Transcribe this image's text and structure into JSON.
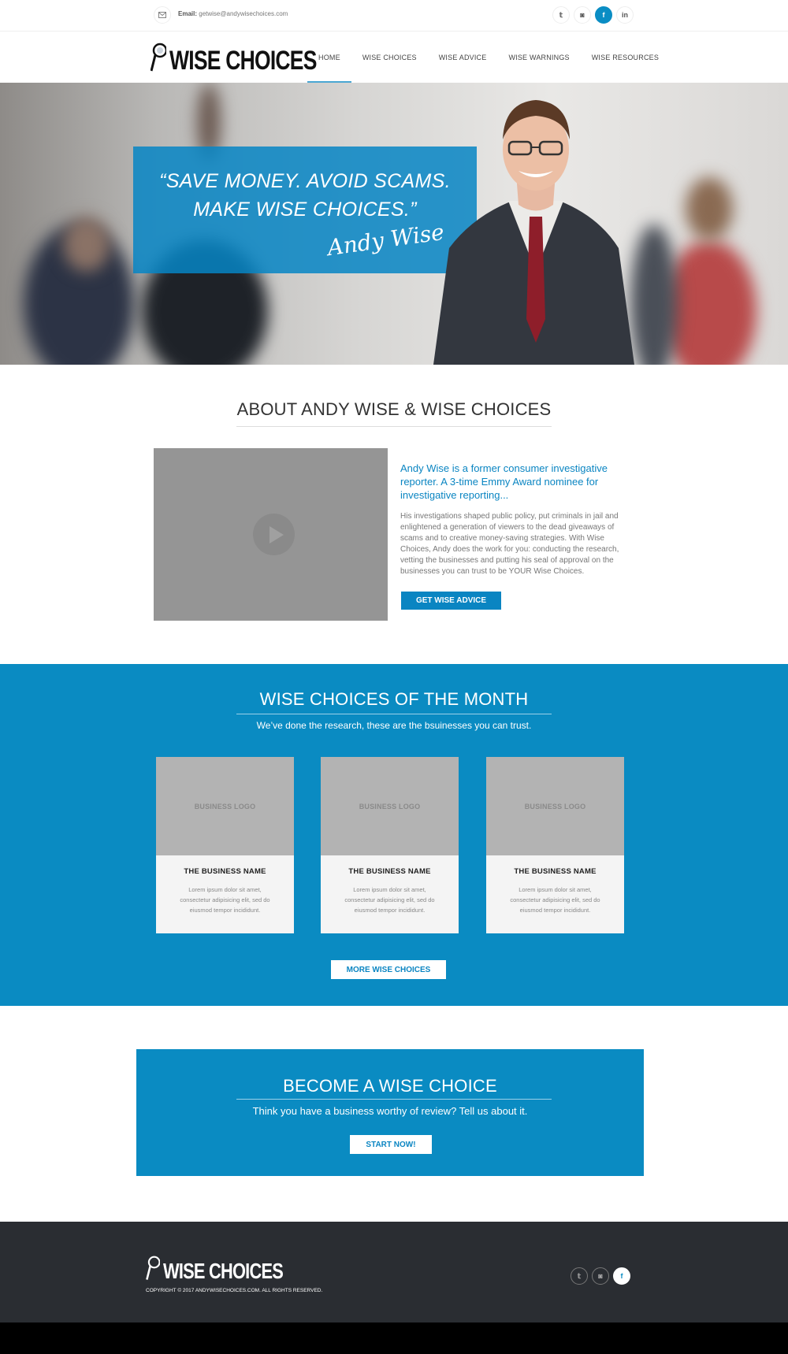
{
  "topbar": {
    "email_label": "Email:",
    "email": "getwise@andywisechoices.com",
    "icons": [
      "twitter-icon",
      "instagram-icon",
      "facebook-icon",
      "linkedin-icon"
    ],
    "social": [
      {
        "name": "twitter",
        "glyph": "𝕥"
      },
      {
        "name": "instagram",
        "glyph": "◙"
      },
      {
        "name": "facebook",
        "glyph": "f"
      },
      {
        "name": "linkedin",
        "glyph": "in"
      }
    ]
  },
  "header": {
    "logo_text": "WISE CHOICES",
    "nav": [
      {
        "label": "HOME",
        "active": true
      },
      {
        "label": "WISE CHOICES"
      },
      {
        "label": "WISE ADVICE"
      },
      {
        "label": "WISE WARNINGS"
      },
      {
        "label": "WISE RESOURCES"
      }
    ]
  },
  "hero": {
    "quote_line1": "“SAVE MONEY. AVOID SCAMS.",
    "quote_line2": "MAKE WISE CHOICES.”",
    "signature": "Andy Wise"
  },
  "about": {
    "title": "ABOUT ANDY WISE & WISE CHOICES",
    "lead": "Andy Wise is a former consumer investigative reporter. A 3-time Emmy Award nominee for investigative reporting...",
    "body": "His investigations shaped public policy, put criminals in jail and enlightened a generation of viewers to the dead giveaways of scams and to creative money-saving strategies. With Wise Choices, Andy does the work for you: conducting the research, vetting the businesses and putting his seal of approval on the businesses you can trust to be YOUR Wise Choices.",
    "button": "GET WISE ADVICE"
  },
  "month": {
    "title": "WISE CHOICES OF THE MONTH",
    "subtitle": "We’ve done the research, these are the bsuinesses you can trust.",
    "cards": [
      {
        "logo": "BUSINESS LOGO",
        "name": "THE BUSINESS NAME",
        "desc": "Lorem ipsum dolor sit amet, consectetur adipisicing elit, sed do eiusmod tempor incididunt."
      },
      {
        "logo": "BUSINESS LOGO",
        "name": "THE BUSINESS NAME",
        "desc": "Lorem ipsum dolor sit amet, consectetur adipisicing elit, sed do eiusmod tempor incididunt."
      },
      {
        "logo": "BUSINESS LOGO",
        "name": "THE BUSINESS NAME",
        "desc": "Lorem ipsum dolor sit amet, consectetur adipisicing elit, sed do eiusmod tempor incididunt."
      }
    ],
    "button": "MORE WISE CHOICES"
  },
  "become": {
    "title": "BECOME A WISE CHOICE",
    "subtitle": "Think you have a business worthy of review? Tell us about it.",
    "button": "START NOW!"
  },
  "footer": {
    "logo_text": "WISE CHOICES",
    "copyright": "COPYRIGHT © 2017 ANDYWISECHOICES.COM. ALL RIGHTS RESERVED.",
    "social": [
      {
        "name": "twitter",
        "glyph": "𝕥"
      },
      {
        "name": "instagram",
        "glyph": "◙"
      },
      {
        "name": "facebook",
        "glyph": "f"
      }
    ]
  },
  "colors": {
    "brand_blue": "#0a8bc2",
    "footer_bg": "#2a2d32"
  }
}
